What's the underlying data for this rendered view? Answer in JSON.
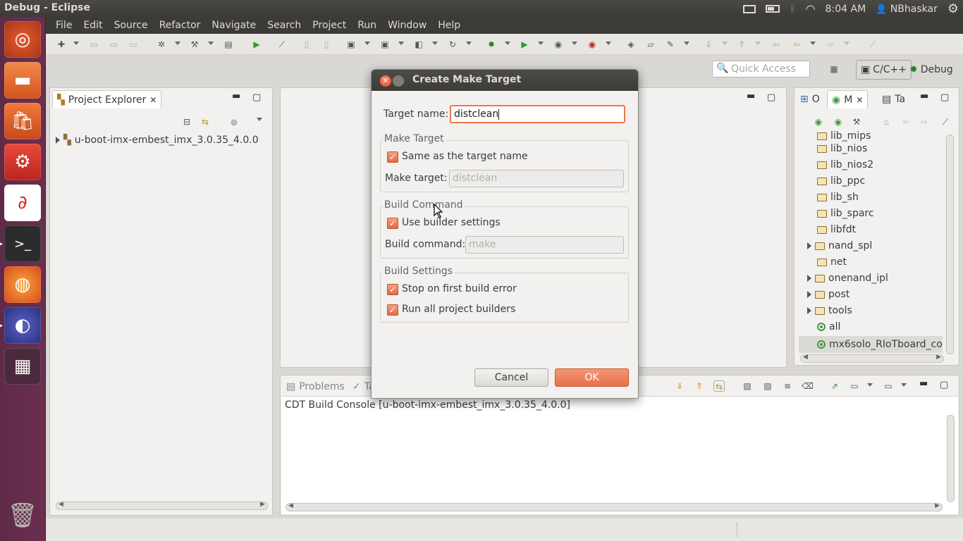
{
  "window": {
    "title": "Debug - Eclipse"
  },
  "tray": {
    "time": "8:04 AM",
    "user": "NBhaskar"
  },
  "menu": [
    "File",
    "Edit",
    "Source",
    "Refactor",
    "Navigate",
    "Search",
    "Project",
    "Run",
    "Window",
    "Help"
  ],
  "quick_access": {
    "placeholder": "Quick Access"
  },
  "perspectives": {
    "cpp": "C/C++",
    "debug": "Debug"
  },
  "project_explorer": {
    "tab_label": "Project Explorer",
    "project": "u-boot-imx-embest_imx_3.0.35_4.0.0"
  },
  "right_panel": {
    "tabs": [
      "O",
      "M",
      "Ta"
    ],
    "items": [
      {
        "label": "lib_mips",
        "type": "folder",
        "expandable": false
      },
      {
        "label": "lib_nios",
        "type": "folder",
        "expandable": false
      },
      {
        "label": "lib_nios2",
        "type": "folder",
        "expandable": false
      },
      {
        "label": "lib_ppc",
        "type": "folder",
        "expandable": false
      },
      {
        "label": "lib_sh",
        "type": "folder",
        "expandable": false
      },
      {
        "label": "lib_sparc",
        "type": "folder",
        "expandable": false
      },
      {
        "label": "libfdt",
        "type": "folder",
        "expandable": false
      },
      {
        "label": "nand_spl",
        "type": "folder",
        "expandable": true
      },
      {
        "label": "net",
        "type": "folder",
        "expandable": false
      },
      {
        "label": "onenand_ipl",
        "type": "folder",
        "expandable": true
      },
      {
        "label": "post",
        "type": "folder",
        "expandable": true
      },
      {
        "label": "tools",
        "type": "folder",
        "expandable": true
      },
      {
        "label": "all",
        "type": "target",
        "expandable": false
      },
      {
        "label": "mx6solo_RIoTboard_co",
        "type": "target",
        "expandable": false
      }
    ]
  },
  "bottom_panel": {
    "tabs": [
      "Problems",
      "Ta"
    ],
    "console_title": "CDT Build Console [u-boot-imx-embest_imx_3.0.35_4.0.0]"
  },
  "dialog": {
    "title": "Create Make Target",
    "target_name_label": "Target name:",
    "target_name_value": "distclean",
    "make_target_group": "Make Target",
    "same_as_target": "Same as the target name",
    "make_target_label": "Make target:",
    "make_target_value": "distclean",
    "build_command_group": "Build Command",
    "use_builder_settings": "Use builder settings",
    "build_command_label": "Build command:",
    "build_command_value": "make",
    "build_settings_group": "Build Settings",
    "stop_on_error": "Stop on first build error",
    "run_all_builders": "Run all project builders",
    "cancel": "Cancel",
    "ok": "OK"
  },
  "colors": {
    "accent": "#e76f49",
    "launcher": "#6b2f4f",
    "panel_dark": "#3c3b37"
  }
}
